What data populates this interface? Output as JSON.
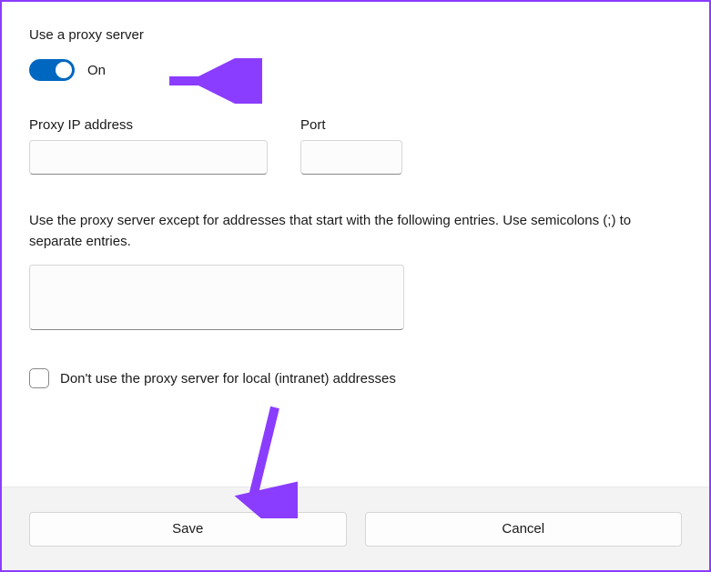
{
  "heading": "Use a proxy server",
  "toggle": {
    "state_label": "On",
    "on": true
  },
  "ip_field": {
    "label": "Proxy IP address",
    "value": ""
  },
  "port_field": {
    "label": "Port",
    "value": ""
  },
  "exceptions": {
    "description": "Use the proxy server except for addresses that start with the following entries. Use semicolons (;) to separate entries.",
    "value": ""
  },
  "local_bypass": {
    "label": "Don't use the proxy server for local (intranet) addresses",
    "checked": false
  },
  "buttons": {
    "save": "Save",
    "cancel": "Cancel"
  }
}
